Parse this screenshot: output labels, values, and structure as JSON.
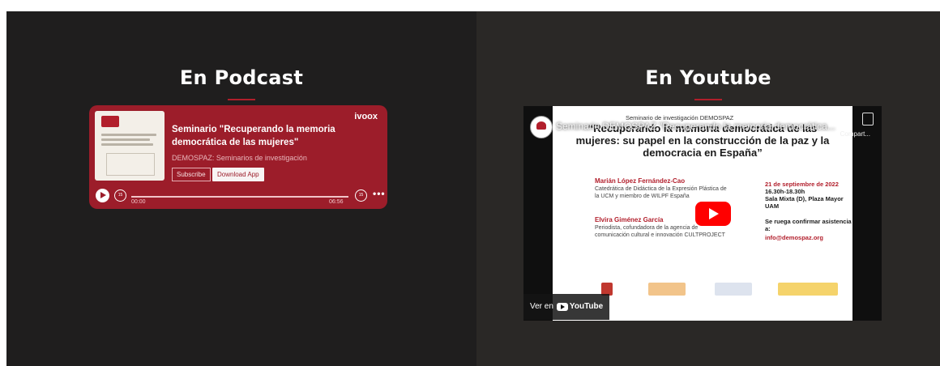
{
  "podcast_section": {
    "title": "En Podcast",
    "player": {
      "brand": "ivoox",
      "episode_title": "Seminario \"Recuperando la memoria democrática de las mujeres\"",
      "show_name": "DEMOSPAZ: Seminarios de investigación",
      "subscribe_label": "Subscribe",
      "download_label": "Download App",
      "rewind_label": "15",
      "forward_label": "15",
      "time_current": "00:00",
      "time_total": "06:56",
      "more_label": "•••"
    }
  },
  "youtube_section": {
    "title": "En Youtube",
    "embed": {
      "video_title": "Seminario DEMOSPAZ \"Recuperando la memoria democrática...",
      "share_label": "Compart...",
      "watch_on_label": "Ver en",
      "youtube_wordmark": "YouTube",
      "slide": {
        "kicker": "Seminario de investigación DEMOSPAZ",
        "headline": "“Recuperando la memoria democrática de las mujeres: su papel en la construcción de la paz y la democracia en España”",
        "speaker1_name": "Marián López Fernández-Cao",
        "speaker1_desc": "Catedrática de Didáctica de la Expresión Plástica de la UCM y miembro de WILPF España",
        "speaker2_name": "Elvira Giménez García",
        "speaker2_desc": "Periodista, cofundadora de la agencia de comunicación cultural e innovación CULTPROJECT",
        "event_date": "21 de septiembre de 2022",
        "event_time": "16.30h-18.30h",
        "event_place": "Sala Mixta (D), Plaza Mayor UAM",
        "rsvp": "Se ruega confirmar asistencia a:",
        "rsvp_email": "info@demospaz.org"
      }
    }
  },
  "colors": {
    "podcast_card": "#9c1d2a",
    "accent": "#b01f2b",
    "left_panel": "#1f1e1e",
    "right_panel": "#2a2826",
    "youtube_red": "#ff0000"
  }
}
